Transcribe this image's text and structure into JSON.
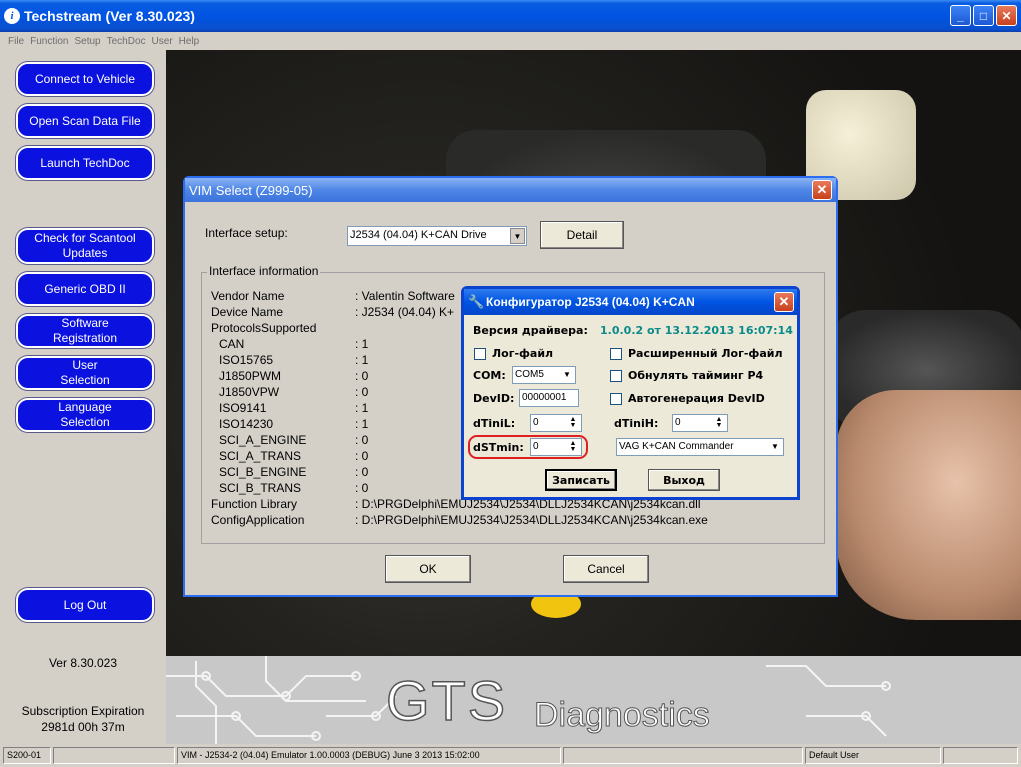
{
  "window": {
    "title": "Techstream (Ver 8.30.023)"
  },
  "menu": [
    "File",
    "Function",
    "Setup",
    "TechDoc",
    "User",
    "Help"
  ],
  "sidebar": {
    "buttons": [
      "Connect to Vehicle",
      "Open Scan Data File",
      "Launch TechDoc",
      "Check for Scantool Updates",
      "Generic OBD II",
      "Software Registration",
      "User Selection",
      "Language Selection",
      "Log Out"
    ],
    "version": "Ver 8.30.023",
    "subscription_label": "Subscription Expiration",
    "subscription_value": "2981d 00h 37m"
  },
  "brand": {
    "gts": "GTS",
    "diagnostics": "Diagnostics"
  },
  "vim_dialog": {
    "title": "VIM Select (Z999-05)",
    "interface_setup_label": "Interface setup:",
    "interface_value": "J2534 (04.04) K+CAN Drive",
    "detail_button": "Detail",
    "info_group_label": "Interface information",
    "info_keys": [
      "Vendor Name",
      "Device Name",
      "ProtocolsSupported",
      "CAN",
      "ISO15765",
      "J1850PWM",
      "J1850VPW",
      "ISO9141",
      "ISO14230",
      "SCI_A_ENGINE",
      "SCI_A_TRANS",
      "SCI_B_ENGINE",
      "SCI_B_TRANS",
      "Function Library",
      "ConfigApplication"
    ],
    "info_values": [
      ": Valentin Software",
      ": J2534 (04.04) K+",
      "",
      ": 1",
      ": 1",
      ": 0",
      ": 0",
      ": 1",
      ": 1",
      ": 0",
      ": 0",
      ": 0",
      ": 0",
      ": D:\\PRGDelphi\\EMUJ2534\\J2534\\DLLJ2534KCAN\\j2534kcan.dll",
      ": D:\\PRGDelphi\\EMUJ2534\\J2534\\DLLJ2534KCAN\\j2534kcan.exe"
    ],
    "ok_button": "OK",
    "cancel_button": "Cancel"
  },
  "konf_dialog": {
    "title": "Конфигуратор J2534 (04.04) K+CAN",
    "driver_version_label": "Версия драйвера:",
    "driver_version_value": "1.0.0.2 от 13.12.2013 16:07:14",
    "logfile_label": "Лог-файл",
    "ext_logfile_label": "Расширенный Лог-файл",
    "com_label": "COM:",
    "com_value": "COM5",
    "reset_p4_label": "Обнулять тайминг P4",
    "devid_label": "DevID:",
    "devid_value": "00000001",
    "autogen_devid_label": "Автогенерация DevID",
    "dtinil_label": "dTiniL:",
    "dtinil_value": "0",
    "dtinih_label": "dTiniH:",
    "dtinih_value": "0",
    "dstmin_label": "dSTmin:",
    "dstmin_value": "0",
    "mode_value": "VAG K+CAN Commander",
    "write_button": "Записать",
    "exit_button": "Выход",
    "version_color": "#0a8a8a",
    "highlight_color": "#e02020"
  },
  "status": {
    "code": "S200-01",
    "message": "VIM - J2534-2 (04.04) Emulator 1.00.0003 (DEBUG) June 3 2013 15:02:00",
    "user": "Default User"
  }
}
